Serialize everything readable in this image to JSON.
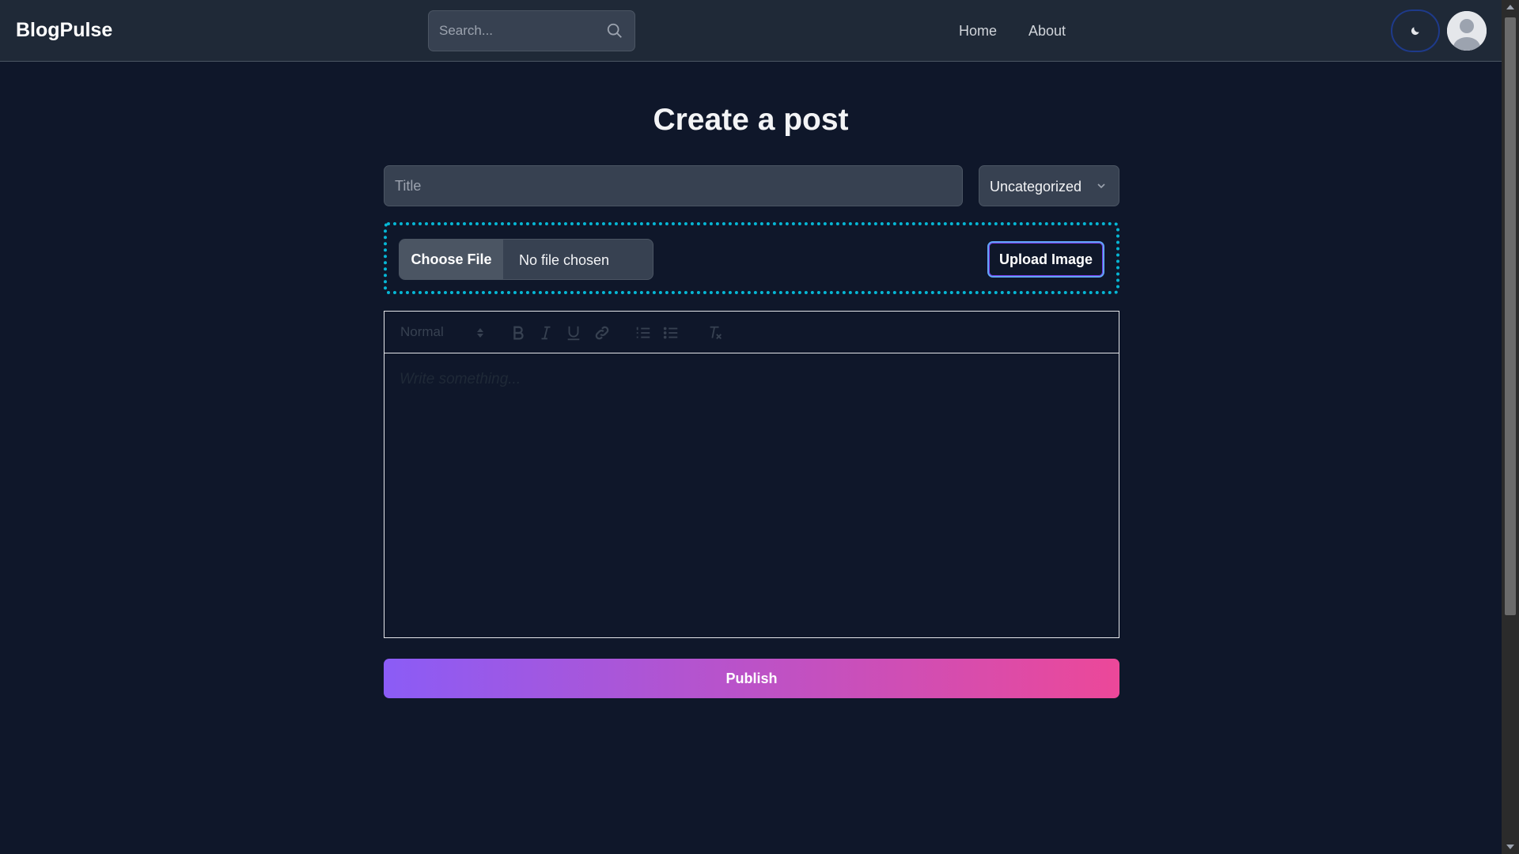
{
  "header": {
    "brand": "BlogPulse",
    "search_placeholder": "Search...",
    "nav": [
      {
        "label": "Home"
      },
      {
        "label": "About"
      }
    ]
  },
  "main": {
    "title": "Create a post",
    "title_placeholder": "Title",
    "category": {
      "selected": "Uncategorized"
    },
    "upload": {
      "choose_label": "Choose File",
      "status": "No file chosen",
      "upload_label": "Upload Image"
    },
    "editor": {
      "format": "Normal",
      "placeholder": "Write something..."
    },
    "publish_label": "Publish"
  },
  "colors": {
    "background": "#0f172a",
    "header": "#1f2937",
    "accent_dotted": "#06b6d4",
    "gradient_start": "#8b5cf6",
    "gradient_end": "#ec4899"
  },
  "icons": {
    "search": "search-icon",
    "theme": "moon-icon",
    "avatar": "user-avatar-icon",
    "chevron": "chevron-down-icon"
  }
}
